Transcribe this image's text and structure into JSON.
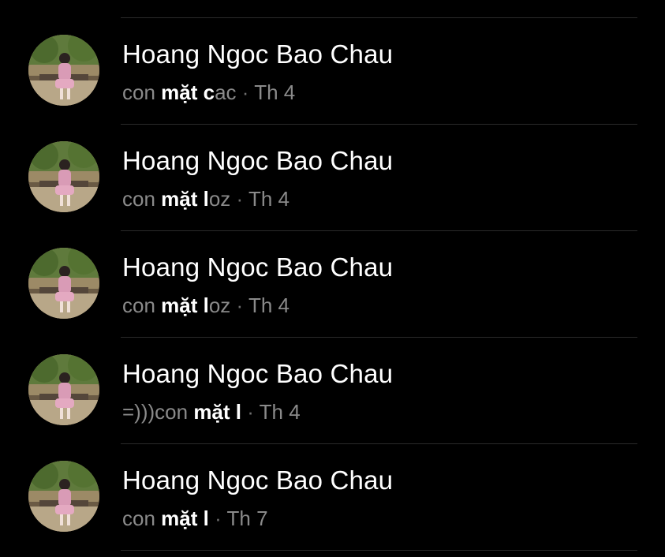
{
  "threads": [
    {
      "name": "Hoang Ngoc Bao Chau",
      "preview_pre": "con ",
      "preview_bold": "mặt c",
      "preview_post": "ac",
      "separator": "·",
      "time": "Th 4"
    },
    {
      "name": "Hoang Ngoc Bao Chau",
      "preview_pre": "con ",
      "preview_bold": "mặt l",
      "preview_post": "oz",
      "separator": "·",
      "time": "Th 4"
    },
    {
      "name": "Hoang Ngoc Bao Chau",
      "preview_pre": "con ",
      "preview_bold": "mặt l",
      "preview_post": "oz",
      "separator": "·",
      "time": "Th 4"
    },
    {
      "name": "Hoang Ngoc Bao Chau",
      "preview_pre": "=)))con ",
      "preview_bold": "mặt l",
      "preview_post": "",
      "separator": "·",
      "time": "Th 4"
    },
    {
      "name": "Hoang Ngoc Bao Chau",
      "preview_pre": "con ",
      "preview_bold": "mặt l",
      "preview_post": "",
      "separator": "·",
      "time": "Th 7"
    }
  ],
  "colors": {
    "background": "#000000",
    "name_text": "#ffffff",
    "preview_text": "#8a8a8a",
    "preview_highlight": "#ffffff",
    "divider": "#2a2a2a"
  }
}
